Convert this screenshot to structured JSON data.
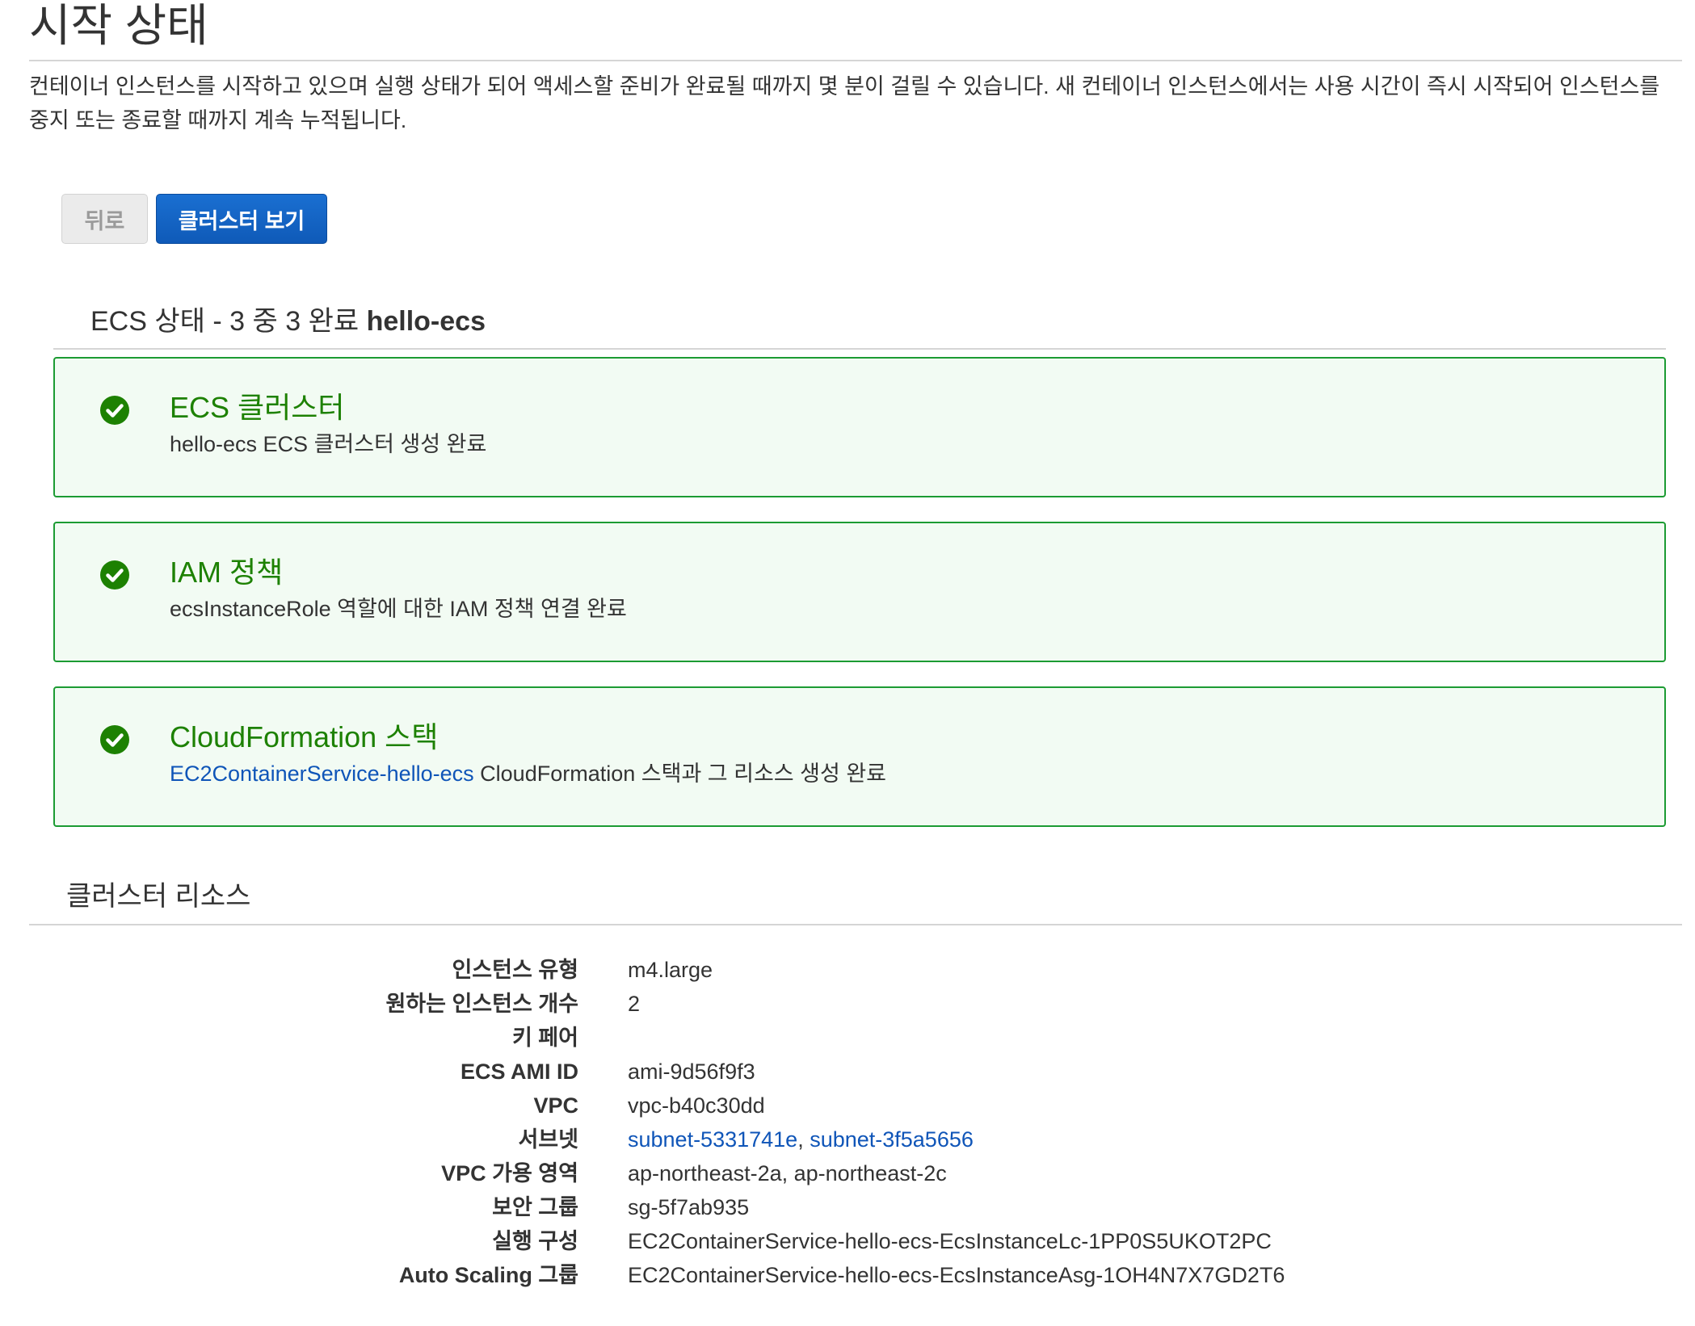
{
  "page": {
    "title": "시작 상태",
    "intro": "컨테이너 인스턴스를 시작하고 있으며 실행 상태가 되어 액세스할 준비가 완료될 때까지 몇 분이 걸릴 수 있습니다. 새 컨테이너 인스턴스에서는 사용 시간이 즉시 시작되어 인스턴스를 중지 또는 종료할 때까지 계속 누적됩니다."
  },
  "buttons": {
    "back_label": "뒤로",
    "view_cluster_label": "클러스터 보기"
  },
  "status": {
    "heading_prefix": "ECS 상태 - 3 중 3 완료",
    "cluster_name": "hello-ecs",
    "cards": [
      {
        "title": "ECS 클러스터",
        "description": "hello-ecs ECS 클러스터 생성 완료",
        "icon": "check-circle-icon",
        "state": "complete"
      },
      {
        "title": "IAM 정책",
        "description": "ecsInstanceRole 역할에 대한 IAM 정책 연결 완료",
        "icon": "check-circle-icon",
        "state": "complete"
      },
      {
        "title": "CloudFormation 스택",
        "description_link": "EC2ContainerService-hello-ecs",
        "description_rest": " CloudFormation 스택과 그 리소스 생성 완료",
        "icon": "check-circle-icon",
        "state": "complete"
      }
    ]
  },
  "resources": {
    "heading": "클러스터 리소스",
    "rows": [
      {
        "label": "인스턴스 유형",
        "value": "m4.large"
      },
      {
        "label": "원하는 인스턴스 개수",
        "value": "2"
      },
      {
        "label": "키 페어",
        "value": ""
      },
      {
        "label": "ECS AMI ID",
        "value": "ami-9d56f9f3"
      },
      {
        "label": "VPC",
        "value": "vpc-b40c30dd"
      },
      {
        "label": "서브넷",
        "value": "subnet-5331741e",
        "value2": "subnet-3f5a5656",
        "separator": ", "
      },
      {
        "label": "VPC 가용 영역",
        "value": "ap-northeast-2a, ap-northeast-2c"
      },
      {
        "label": "보안 그룹",
        "value": "sg-5f7ab935"
      },
      {
        "label": "실행 구성",
        "value": "EC2ContainerService-hello-ecs-EcsInstanceLc-1PP0S5UKOT2PC"
      },
      {
        "label": "Auto Scaling 그룹",
        "value": "EC2ContainerService-hello-ecs-EcsInstanceAsg-1OH4N7X7GD2T6"
      }
    ]
  },
  "colors": {
    "success_green": "#1d8102",
    "card_border": "#1c9b33",
    "card_background": "#f2fbf3",
    "link_blue": "#0f55b8",
    "primary_button": "#1468c9"
  }
}
